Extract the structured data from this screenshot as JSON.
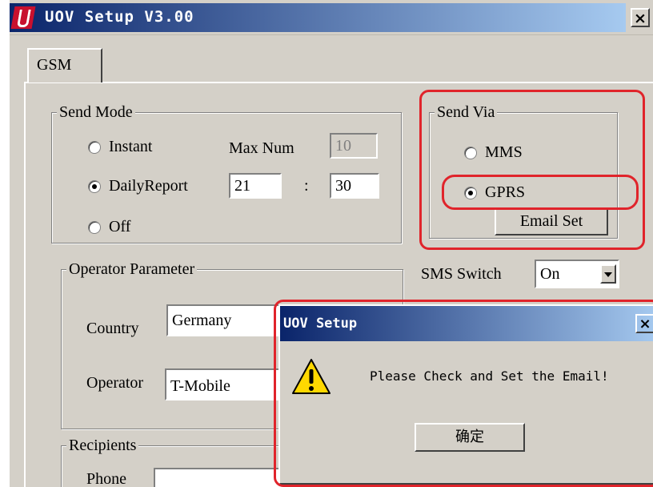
{
  "window": {
    "title": "UOV Setup V3.00",
    "close_label": "×"
  },
  "tabs": [
    {
      "label": "GSM",
      "active": true
    }
  ],
  "send_mode": {
    "title": "Send Mode",
    "options": [
      {
        "label": "Instant",
        "checked": false
      },
      {
        "label": "DailyReport",
        "checked": true
      },
      {
        "label": "Off",
        "checked": false
      }
    ],
    "max_num_label": "Max Num",
    "max_num_value": "10",
    "hour_value": "21",
    "time_separator": ":",
    "minute_value": "30"
  },
  "send_via": {
    "title": "Send Via",
    "options": [
      {
        "label": "MMS",
        "checked": false
      },
      {
        "label": "GPRS",
        "checked": true
      }
    ],
    "email_set_label": "Email Set"
  },
  "operator_parameter": {
    "title": "Operator Parameter",
    "country_label": "Country",
    "country_value": "Germany",
    "operator_label": "Operator",
    "operator_value": "T-Mobile"
  },
  "sms_switch": {
    "label": "SMS Switch",
    "value": "On"
  },
  "recipients": {
    "title": "Recipients",
    "phone_label": "Phone"
  },
  "dialog": {
    "title": "UOV Setup",
    "close_label": "×",
    "message": "Please Check and Set the Email!",
    "ok_label": "确定"
  },
  "colors": {
    "title_bar": "#0a246a",
    "title_bar_gradient_end": "#a6caf0",
    "highlight": "#e0242b",
    "warning_fill": "#ffd800"
  }
}
